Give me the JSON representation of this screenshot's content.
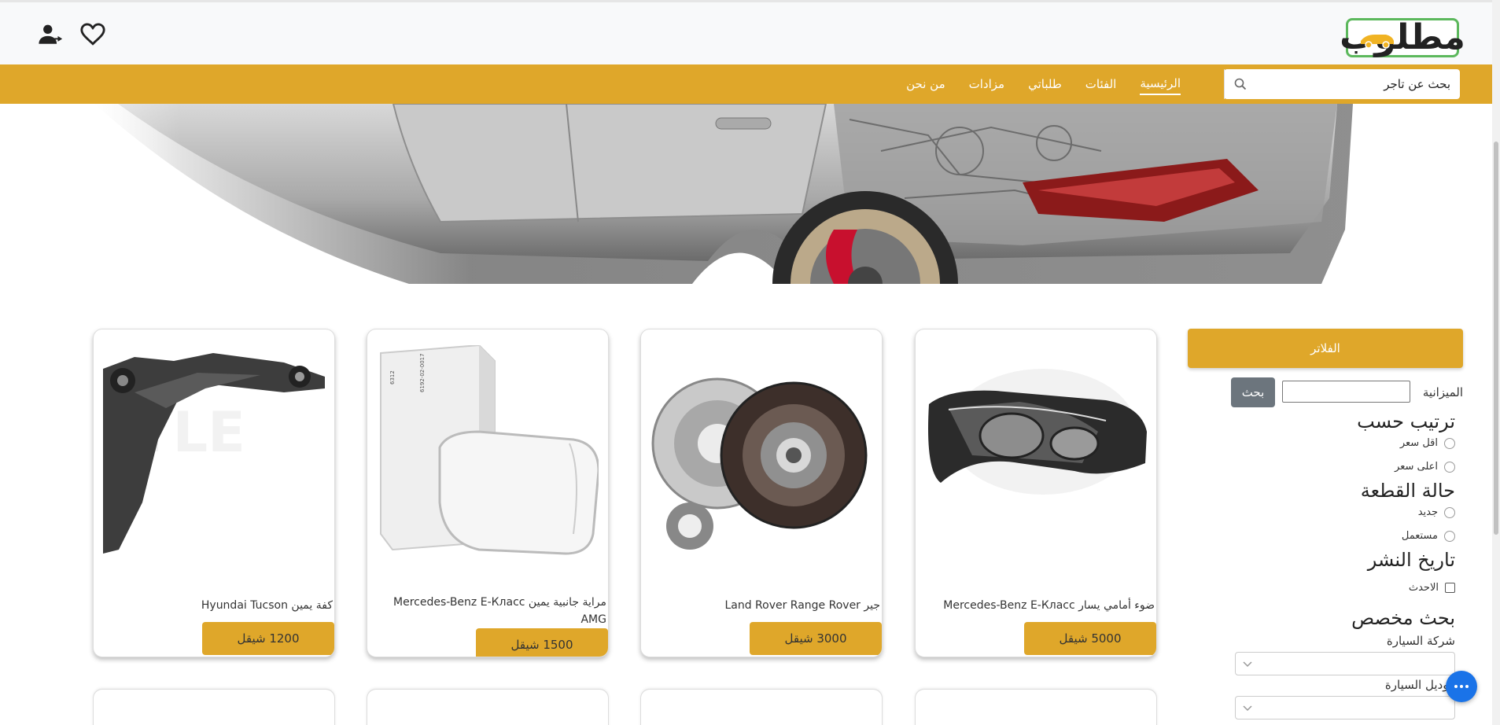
{
  "header": {
    "logo_text": "مطلوب",
    "user_icon": "user-add-icon",
    "heart_icon": "heart-icon"
  },
  "nav": {
    "search_placeholder": "بحث عن تاجر",
    "links": [
      "الرئيسية",
      "الفئات",
      "طلباتي",
      "مزادات",
      "من نحن"
    ],
    "active": "الرئيسية"
  },
  "sidebar": {
    "filters_label": "الفلاتر",
    "budget_label": "الميزانية",
    "budget_button": "بحث",
    "sort_title": "ترتيب حسب",
    "sort_options": [
      "اقل سعر",
      "اعلى سعر"
    ],
    "condition_title": "حالة القطعة",
    "condition_options": [
      "جديد",
      "مستعمل"
    ],
    "date_title": "تاريخ النشر",
    "date_option": "الاحدث",
    "custom_title": "بحث مخصص",
    "car_company_label": "شركة السيارة",
    "car_model_label": "موديل السيارة"
  },
  "products": [
    {
      "title": "ضوء أمامي يسار Mercedes-Benz E-Класс",
      "price": "5000 شيقل",
      "image": "headlight"
    },
    {
      "title": "جير Land Rover Range Rover",
      "price": "3000 شيقل",
      "image": "clutch"
    },
    {
      "title": "مراية جانبية يمين Mercedes-Benz E-Класс AMG",
      "price": "1500 شيقل",
      "image": "mirror"
    },
    {
      "title": "كفة يمين Hyundai Tucson",
      "price": "1200 شيقل",
      "image": "control-arm"
    }
  ],
  "colors": {
    "accent": "#dfa72a",
    "logo_border": "#5cb85c",
    "chat": "#1a73e8"
  }
}
